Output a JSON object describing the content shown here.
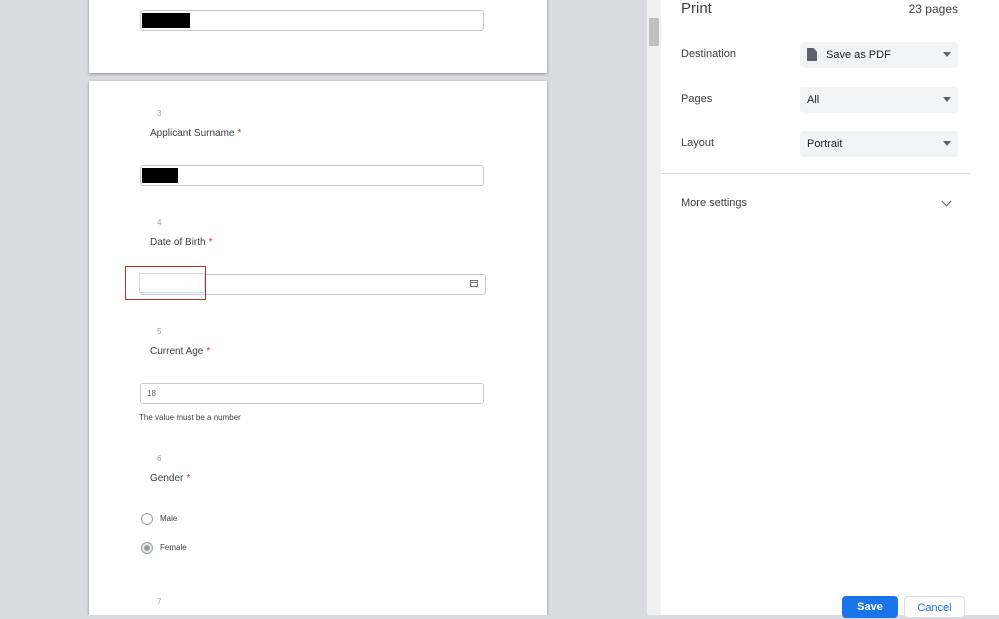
{
  "preview": {
    "questions": [
      {
        "number": "3",
        "label": "Applicant Surname",
        "required": "*"
      },
      {
        "number": "4",
        "label": "Date of Birth",
        "required": "*"
      },
      {
        "number": "5",
        "label": "Current Age",
        "required": "*",
        "value": "18",
        "error": "The value must be a number"
      },
      {
        "number": "6",
        "label": "Gender",
        "required": "*",
        "options": [
          "Male",
          "Female"
        ],
        "selected": "Female"
      },
      {
        "number": "7"
      }
    ]
  },
  "print": {
    "title": "Print",
    "pages_count": "23 pages",
    "destination": {
      "label": "Destination",
      "value": "Save as PDF"
    },
    "pages": {
      "label": "Pages",
      "value": "All"
    },
    "layout": {
      "label": "Layout",
      "value": "Portrait"
    },
    "more_settings": "More settings",
    "save": "Save",
    "cancel": "Cancel"
  }
}
